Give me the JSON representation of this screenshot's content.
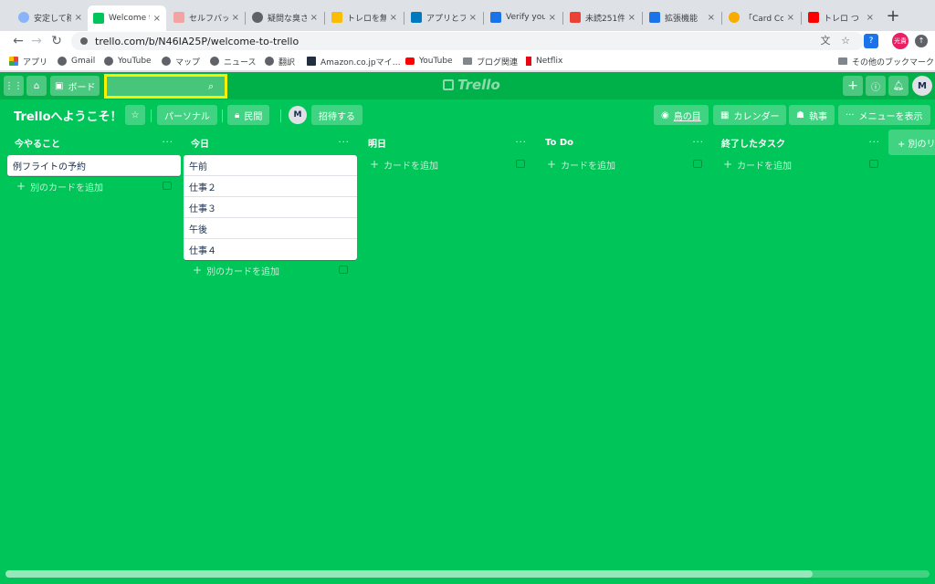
{
  "browser": {
    "tabs": [
      {
        "title": "安定して稼",
        "color": "#8ab4f8"
      },
      {
        "title": "Welcome t",
        "color": "#00c659",
        "active": true
      },
      {
        "title": "セルフバッ",
        "color": "#f4a3a3"
      },
      {
        "title": "疑問な臭さ",
        "color": "#5f6368"
      },
      {
        "title": "トレロを無",
        "color": "#fbbc04"
      },
      {
        "title": "アプリとフ",
        "color": "#0079bf"
      },
      {
        "title": "Verify you",
        "color": "#1a73e8"
      },
      {
        "title": "未読251件",
        "color": "#ea4335"
      },
      {
        "title": "拡張機能",
        "color": "#1a73e8"
      },
      {
        "title": "「Card Co",
        "color": "#f9ab00"
      },
      {
        "title": "トレロ つ",
        "color": "#ff0000"
      }
    ],
    "new_tab": "+",
    "url": "trello.com/b/N46IA25P/welcome-to-trello",
    "profile": "光貴",
    "bookmarks": [
      {
        "label": "アプリ",
        "icon": "apps-grid-icon"
      },
      {
        "label": "Gmail",
        "icon": "globe-icon"
      },
      {
        "label": "YouTube",
        "icon": "globe-icon"
      },
      {
        "label": "マップ",
        "icon": "globe-icon"
      },
      {
        "label": "ニュース",
        "icon": "globe-icon"
      },
      {
        "label": "翻訳",
        "icon": "globe-icon"
      },
      {
        "label": "Amazon.co.jpマイ…",
        "icon": "amazon-icon"
      },
      {
        "label": "YouTube",
        "icon": "youtube-icon"
      },
      {
        "label": "ブログ関連",
        "icon": "folder-icon"
      },
      {
        "label": "Netflix",
        "icon": "netflix-icon"
      }
    ],
    "other_bookmarks": "その他のブックマーク"
  },
  "trello": {
    "header": {
      "boards_label": "ボード",
      "search_placeholder": "",
      "logo": "Trello",
      "avatar": "M"
    },
    "board": {
      "title": "Trelloへようこそ！",
      "personal": "パーソナル",
      "visibility": "民間",
      "member": "M",
      "invite": "招待する",
      "view": "鳥の目",
      "calendar": "カレンダー",
      "butler": "執事",
      "menu": "メニューを表示"
    },
    "lists": [
      {
        "title": "今やること",
        "cards": [
          "例フライトの予約"
        ],
        "add": "別のカードを追加"
      },
      {
        "title": "今日",
        "cards": [
          "午前",
          "仕事２",
          "仕事３",
          "午後",
          "仕事４"
        ],
        "add": "別のカードを追加"
      },
      {
        "title": "明日",
        "cards": [],
        "add": "カードを追加"
      },
      {
        "title": "To Do",
        "cards": [],
        "add": "カードを追加"
      },
      {
        "title": "終了したタスク",
        "cards": [],
        "add": "カードを追加"
      }
    ],
    "add_list": "+ 別のリ",
    "colors": {
      "board_bg": "#00c659",
      "header_bg": "#00b049",
      "search_highlight": "#f5f200"
    }
  }
}
